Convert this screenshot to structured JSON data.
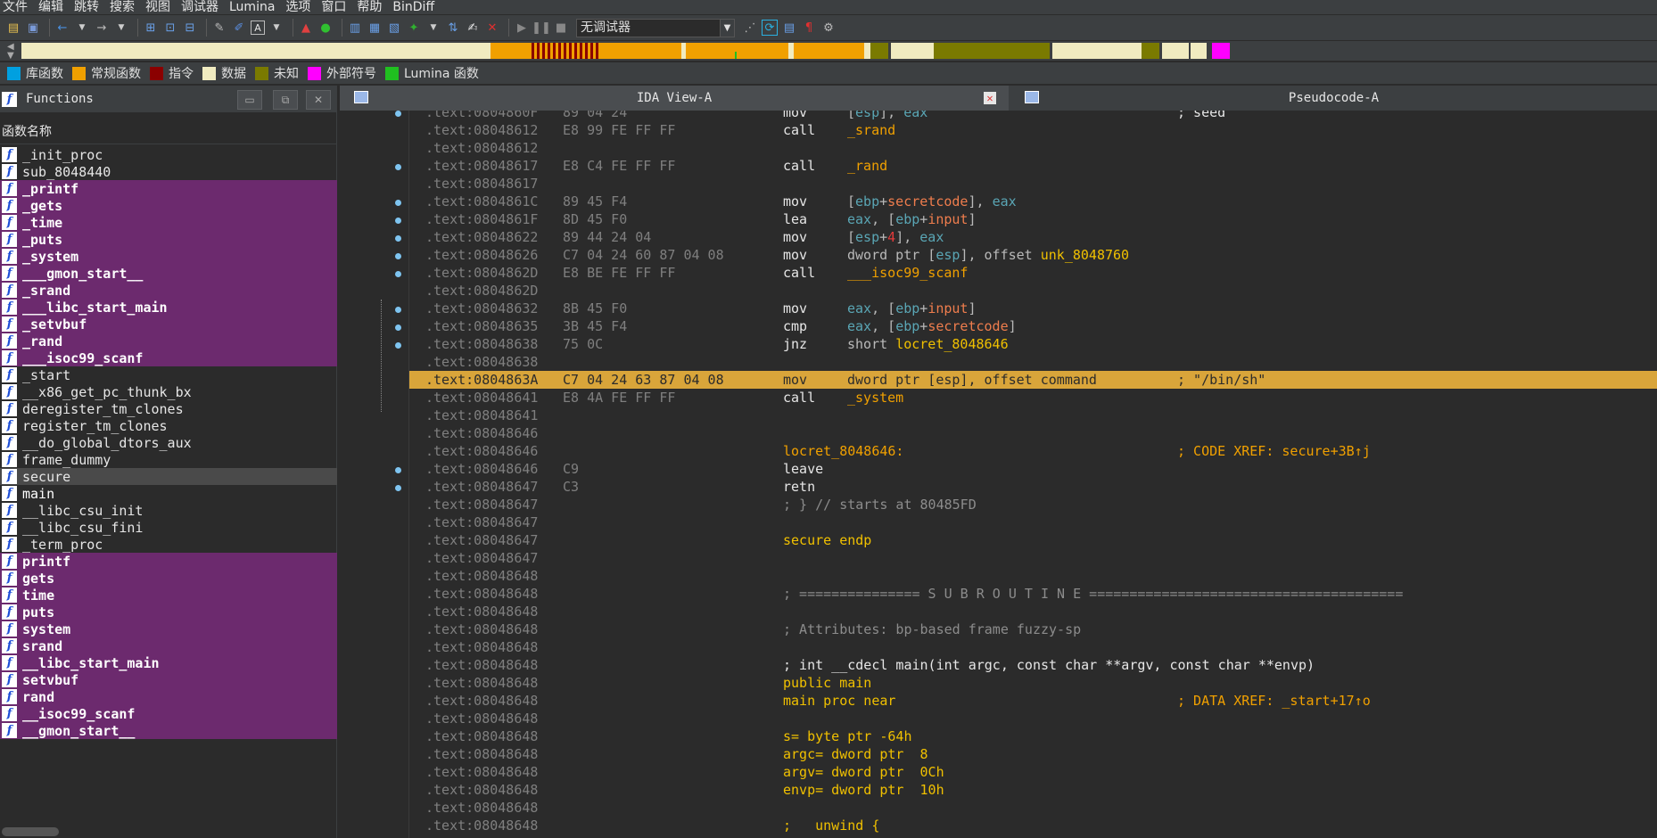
{
  "menu": [
    "文件",
    "编辑",
    "跳转",
    "搜索",
    "视图",
    "调试器",
    "Lumina",
    "选项",
    "窗口",
    "帮助",
    "BinDiff"
  ],
  "toolbar": {
    "debugger_select": "无调试器",
    "icons": [
      "open-icon",
      "save-icon",
      "back-icon",
      "forward-icon",
      "play-icon",
      "pause-icon",
      "stop-icon"
    ]
  },
  "legend": [
    {
      "label": "库函数",
      "color": "#00a0e0"
    },
    {
      "label": "常规函数",
      "color": "#f0a000"
    },
    {
      "label": "指令",
      "color": "#8b0000"
    },
    {
      "label": "数据",
      "color": "#f0ebc0"
    },
    {
      "label": "未知",
      "color": "#7a7a00"
    },
    {
      "label": "外部符号",
      "color": "#ff00ff"
    },
    {
      "label": "Lumina 函数",
      "color": "#20c020"
    }
  ],
  "functions_panel": {
    "title": "Functions",
    "column_header": "函数名称",
    "items": [
      {
        "name": "_init_proc",
        "kind": "reg"
      },
      {
        "name": "sub_8048440",
        "kind": "reg"
      },
      {
        "name": "_printf",
        "kind": "lib"
      },
      {
        "name": "_gets",
        "kind": "lib"
      },
      {
        "name": "_time",
        "kind": "lib"
      },
      {
        "name": "_puts",
        "kind": "lib"
      },
      {
        "name": "_system",
        "kind": "lib"
      },
      {
        "name": "___gmon_start__",
        "kind": "lib"
      },
      {
        "name": "_srand",
        "kind": "lib"
      },
      {
        "name": "___libc_start_main",
        "kind": "lib"
      },
      {
        "name": "_setvbuf",
        "kind": "lib"
      },
      {
        "name": "_rand",
        "kind": "lib"
      },
      {
        "name": "___isoc99_scanf",
        "kind": "lib"
      },
      {
        "name": "_start",
        "kind": "reg"
      },
      {
        "name": "__x86_get_pc_thunk_bx",
        "kind": "reg"
      },
      {
        "name": "deregister_tm_clones",
        "kind": "reg"
      },
      {
        "name": "register_tm_clones",
        "kind": "reg"
      },
      {
        "name": "__do_global_dtors_aux",
        "kind": "reg"
      },
      {
        "name": "frame_dummy",
        "kind": "reg"
      },
      {
        "name": "secure",
        "kind": "sel"
      },
      {
        "name": "main",
        "kind": "import"
      },
      {
        "name": "__libc_csu_init",
        "kind": "reg"
      },
      {
        "name": "__libc_csu_fini",
        "kind": "reg"
      },
      {
        "name": "_term_proc",
        "kind": "reg"
      },
      {
        "name": "printf",
        "kind": "lib"
      },
      {
        "name": "gets",
        "kind": "lib"
      },
      {
        "name": "time",
        "kind": "lib"
      },
      {
        "name": "puts",
        "kind": "lib"
      },
      {
        "name": "system",
        "kind": "lib"
      },
      {
        "name": "srand",
        "kind": "lib"
      },
      {
        "name": "__libc_start_main",
        "kind": "lib"
      },
      {
        "name": "setvbuf",
        "kind": "lib"
      },
      {
        "name": "rand",
        "kind": "lib"
      },
      {
        "name": "__isoc99_scanf",
        "kind": "lib"
      },
      {
        "name": "__gmon_start__",
        "kind": "lib"
      }
    ]
  },
  "tabs": {
    "ida_view": "IDA View-A",
    "pseudocode": "Pseudocode-A"
  },
  "code": [
    {
      "addr": ".text:0804860F",
      "bytes": "89 04 24",
      "mn": "mov",
      "op": "[esp], eax",
      "cmt": "; seed",
      "bp": true
    },
    {
      "addr": ".text:08048612",
      "bytes": "E8 99 FE FF FF",
      "mn": "call",
      "op": "_srand"
    },
    {
      "addr": ".text:08048612"
    },
    {
      "addr": ".text:08048617",
      "bytes": "E8 C4 FE FF FF",
      "mn": "call",
      "op": "_rand",
      "bp": true
    },
    {
      "addr": ".text:08048617"
    },
    {
      "addr": ".text:0804861C",
      "bytes": "89 45 F4",
      "mn": "mov",
      "op": "[ebp+secretcode], eax",
      "bp": true
    },
    {
      "addr": ".text:0804861F",
      "bytes": "8D 45 F0",
      "mn": "lea",
      "op": "eax, [ebp+input]",
      "bp": true
    },
    {
      "addr": ".text:08048622",
      "bytes": "89 44 24 04",
      "mn": "mov",
      "op": "[esp+4], eax",
      "bp": true
    },
    {
      "addr": ".text:08048626",
      "bytes": "C7 04 24 60 87 04 08",
      "mn": "mov",
      "op": "dword ptr [esp], offset unk_8048760",
      "bp": true
    },
    {
      "addr": ".text:0804862D",
      "bytes": "E8 BE FE FF FF",
      "mn": "call",
      "op": "___isoc99_scanf",
      "bp": true
    },
    {
      "addr": ".text:0804862D"
    },
    {
      "addr": ".text:08048632",
      "bytes": "8B 45 F0",
      "mn": "mov",
      "op": "eax, [ebp+input]",
      "bp": true
    },
    {
      "addr": ".text:08048635",
      "bytes": "3B 45 F4",
      "mn": "cmp",
      "op": "eax, [ebp+secretcode]",
      "bp": true
    },
    {
      "addr": ".text:08048638",
      "bytes": "75 0C",
      "mn": "jnz",
      "op": "short locret_8048646",
      "bp": true
    },
    {
      "addr": ".text:08048638"
    },
    {
      "addr": ".text:0804863A",
      "bytes": "C7 04 24 63 87 04 08",
      "mn": "mov",
      "op": "dword ptr [esp], offset command",
      "cmt": "; \"/bin/sh\"",
      "hl": true
    },
    {
      "addr": ".text:08048641",
      "bytes": "E8 4A FE FF FF",
      "mn": "call",
      "op": "_system"
    },
    {
      "addr": ".text:08048641"
    },
    {
      "addr": ".text:08048646"
    },
    {
      "addr": ".text:08048646",
      "label": "locret_8048646:",
      "cmt": "; CODE XREF: secure+3B↑j"
    },
    {
      "addr": ".text:08048646",
      "bytes": "C9",
      "mn": "leave",
      "bp": true
    },
    {
      "addr": ".text:08048647",
      "bytes": "C3",
      "mn": "retn",
      "bp": true
    },
    {
      "addr": ".text:08048647",
      "text": "; } // starts at 80485FD"
    },
    {
      "addr": ".text:08048647"
    },
    {
      "addr": ".text:08048647",
      "text": "secure endp"
    },
    {
      "addr": ".text:08048647"
    },
    {
      "addr": ".text:08048648"
    },
    {
      "addr": ".text:08048648",
      "text": "; =============== S U B R O U T I N E ======================================="
    },
    {
      "addr": ".text:08048648"
    },
    {
      "addr": ".text:08048648",
      "text": "; Attributes: bp-based frame fuzzy-sp"
    },
    {
      "addr": ".text:08048648"
    },
    {
      "addr": ".text:08048648",
      "text": "; int __cdecl main(int argc, const char **argv, const char **envp)"
    },
    {
      "addr": ".text:08048648",
      "text": "public main"
    },
    {
      "addr": ".text:08048648",
      "text": "main proc near",
      "cmt": "; DATA XREF: _start+17↑o"
    },
    {
      "addr": ".text:08048648"
    },
    {
      "addr": ".text:08048648",
      "text": "s= byte ptr -64h"
    },
    {
      "addr": ".text:08048648",
      "text": "argc= dword ptr  8"
    },
    {
      "addr": ".text:08048648",
      "text": "argv= dword ptr  0Ch"
    },
    {
      "addr": ".text:08048648",
      "text": "envp= dword ptr  10h"
    },
    {
      "addr": ".text:08048648"
    },
    {
      "addr": ".text:08048648",
      "text": ";   unwind {"
    }
  ]
}
